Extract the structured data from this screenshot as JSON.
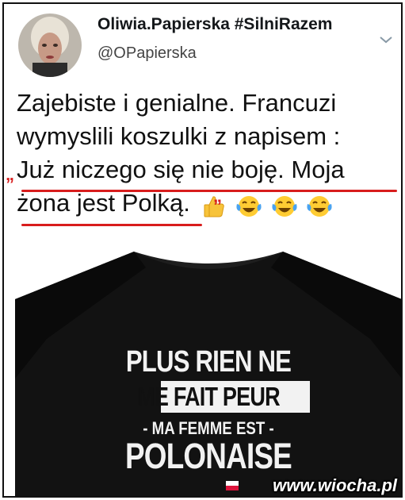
{
  "profile": {
    "display_name": "Oliwia.Papierska #SilniRazem",
    "handle": "@OPapierska"
  },
  "tweet": {
    "lines": [
      "Zajebiste i genialne. Francuzi",
      "wymyslili koszulki z napisem :",
      "Już niczego się nie boję. Moja",
      "żona jest Polką."
    ],
    "emojis": [
      "thumbs-up-icon",
      "tears-of-joy-icon",
      "tears-of-joy-icon",
      "tears-of-joy-icon"
    ],
    "highlight_color": "#d81d1d"
  },
  "media": {
    "shirt_lines": [
      "PLUS RIEN NE",
      "ME FAIT PEUR",
      "- MA FEMME EST -",
      "POLONAISE"
    ],
    "flag": "poland-flag-icon",
    "watermark": "www.wiocha.pl"
  }
}
